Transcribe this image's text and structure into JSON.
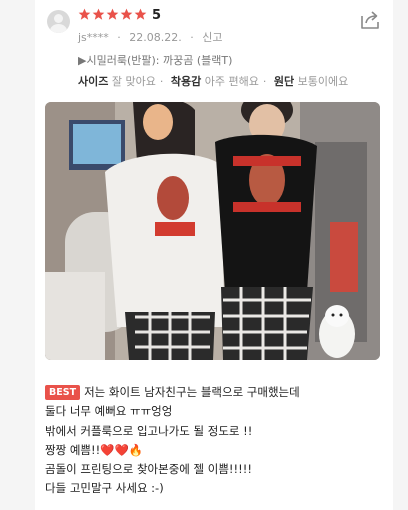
{
  "review": {
    "rating": "5",
    "stars_filled": 5,
    "user": "js****",
    "date": "22.08.22.",
    "report": "신고",
    "option": "▶시밀러룩(반팔): 까꿍곰 (블랙T)",
    "tags": [
      {
        "label": "사이즈",
        "value": "잘 맞아요"
      },
      {
        "label": "착용감",
        "value": "아주 편해요"
      },
      {
        "label": "원단",
        "value": "보통이에요"
      }
    ],
    "badge": "BEST",
    "lines": [
      "저는 화이트 남자친구는 블랙으로 구매했는데",
      "둘다 너무 예뻐요 ㅠㅠ엉엉",
      "밖에서 커플룩으로 입고나가도 될 정도로 !!",
      "짱짱 예쁨!!❤️❤️🔥",
      "곰돌이 프린팅으로 찾아본중에 젤 이쁨!!!!!",
      "다들 고민말구 사세요 :-) "
    ]
  },
  "icons": {
    "avatar": "default-user-avatar",
    "share": "share-icon",
    "star": "star-icon"
  },
  "colors": {
    "star": "#e9524a",
    "badge": "#e9524a",
    "meta_text": "#999999"
  }
}
